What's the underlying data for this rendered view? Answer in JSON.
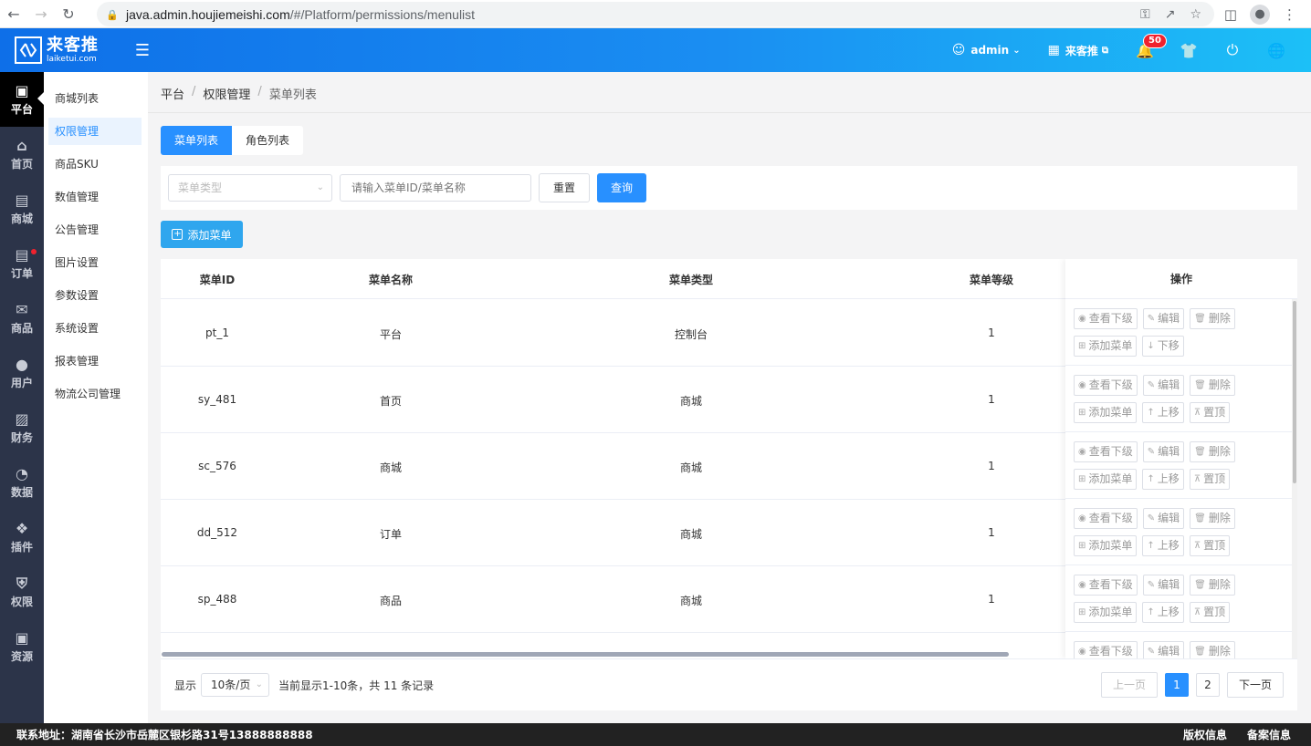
{
  "browser": {
    "url_host": "java.admin.houjiemeishi.com",
    "url_path": "/#/Platform/permissions/menulist"
  },
  "header": {
    "logo_cn": "来客推",
    "logo_en": "laiketui.com",
    "user": "admin",
    "store": "来客推",
    "notify_count": "50"
  },
  "main_menu": [
    {
      "label": "平台",
      "icon": "platform-icon"
    },
    {
      "label": "首页",
      "icon": "home-icon"
    },
    {
      "label": "商城",
      "icon": "mall-icon"
    },
    {
      "label": "订单",
      "icon": "order-icon"
    },
    {
      "label": "商品",
      "icon": "goods-icon"
    },
    {
      "label": "用户",
      "icon": "user-icon"
    },
    {
      "label": "财务",
      "icon": "wallet-icon"
    },
    {
      "label": "数据",
      "icon": "pie-icon"
    },
    {
      "label": "插件",
      "icon": "puzzle-icon"
    },
    {
      "label": "权限",
      "icon": "shield-icon"
    },
    {
      "label": "资源",
      "icon": "image-icon"
    }
  ],
  "sub_menu": [
    "商城列表",
    "权限管理",
    "商品SKU",
    "数值管理",
    "公告管理",
    "图片设置",
    "参数设置",
    "系统设置",
    "报表管理",
    "物流公司管理"
  ],
  "breadcrumb": [
    "平台",
    "权限管理",
    "菜单列表"
  ],
  "tabs": [
    "菜单列表",
    "角色列表"
  ],
  "filter": {
    "type_placeholder": "菜单类型",
    "search_placeholder": "请输入菜单ID/菜单名称",
    "reset": "重置",
    "query": "查询"
  },
  "add_button": "添加菜单",
  "table": {
    "headers": {
      "id": "菜单ID",
      "name": "菜单名称",
      "type": "菜单类型",
      "level": "菜单等级",
      "ops": "操作"
    },
    "rows": [
      {
        "id": "pt_1",
        "name": "平台",
        "type": "控制台",
        "level": "1"
      },
      {
        "id": "sy_481",
        "name": "首页",
        "type": "商城",
        "level": "1"
      },
      {
        "id": "sc_576",
        "name": "商城",
        "type": "商城",
        "level": "1"
      },
      {
        "id": "dd_512",
        "name": "订单",
        "type": "商城",
        "level": "1"
      },
      {
        "id": "sp_488",
        "name": "商品",
        "type": "商城",
        "level": "1"
      }
    ],
    "ops": {
      "view": "查看下级",
      "edit": "编辑",
      "delete": "删除",
      "add": "添加菜单",
      "up": "上移",
      "down": "下移",
      "top": "置顶"
    }
  },
  "pager": {
    "show": "显示",
    "size": "10条/页",
    "info": "当前显示1-10条，共 11 条记录",
    "prev": "上一页",
    "next": "下一页",
    "pages": [
      "1",
      "2"
    ]
  },
  "footer": {
    "address": "联系地址：湖南省长沙市岳麓区银杉路31号13888888888",
    "copyright": "版权信息",
    "icp": "备案信息"
  }
}
